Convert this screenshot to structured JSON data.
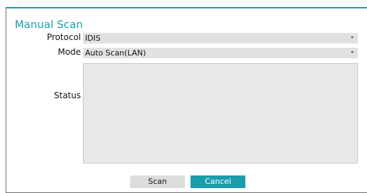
{
  "dialog": {
    "title": "Manual Scan",
    "accent_color": "#1a9dab"
  },
  "protocol": {
    "label": "Protocol",
    "value": "IDIS",
    "icon": "chevron-down-icon"
  },
  "mode": {
    "label": "Mode",
    "value": "Auto Scan(LAN)",
    "icon": "chevron-down-icon"
  },
  "status": {
    "label": "Status",
    "value": ""
  },
  "buttons": {
    "scan": "Scan",
    "cancel": "Cancel"
  }
}
